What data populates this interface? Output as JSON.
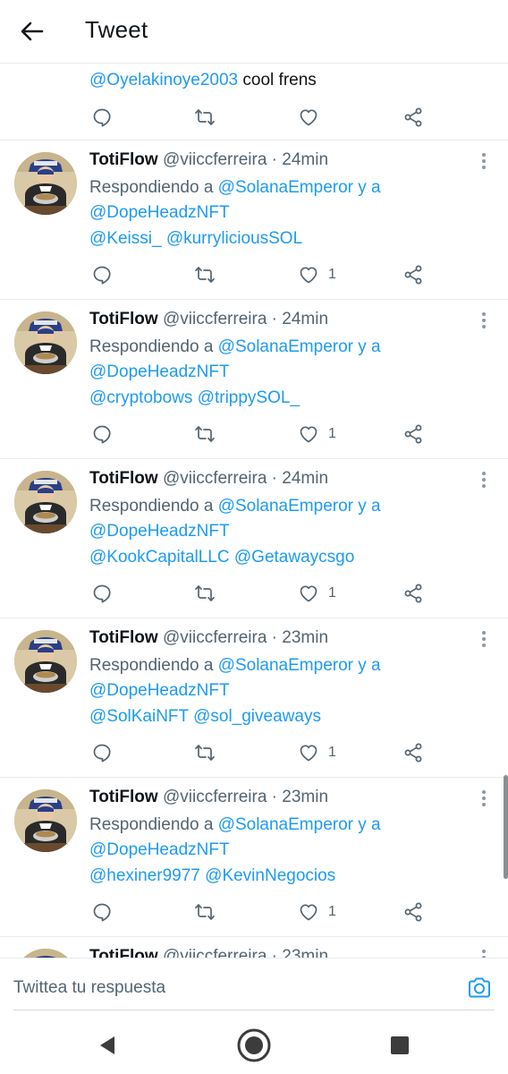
{
  "header": {
    "title": "Tweet"
  },
  "partial_tweet": {
    "mention": "@Oyelakinoye2003",
    "text": "cool frens"
  },
  "tweets": [
    {
      "name": "TotiFlow",
      "handle": "@viiccferreira · 24min",
      "reply_prefix": "Respondiendo a ",
      "reply_user1": "@SolanaEmperor",
      "reply_join": " y a",
      "reply_user2": "@DopeHeadzNFT",
      "mention1": "@Keissi_",
      "mention2": "@kurryliciousSOL",
      "likes": "1"
    },
    {
      "name": "TotiFlow",
      "handle": "@viiccferreira · 24min",
      "reply_prefix": "Respondiendo a ",
      "reply_user1": "@SolanaEmperor",
      "reply_join": " y a",
      "reply_user2": "@DopeHeadzNFT",
      "mention1": "@cryptobows",
      "mention2": "@trippySOL_",
      "likes": "1"
    },
    {
      "name": "TotiFlow",
      "handle": "@viiccferreira · 24min",
      "reply_prefix": "Respondiendo a ",
      "reply_user1": "@SolanaEmperor",
      "reply_join": " y a",
      "reply_user2": "@DopeHeadzNFT",
      "mention1": "@KookCapitalLLC",
      "mention2": "@Getawaycsgo",
      "likes": "1"
    },
    {
      "name": "TotiFlow",
      "handle": "@viiccferreira · 23min",
      "reply_prefix": "Respondiendo a ",
      "reply_user1": "@SolanaEmperor",
      "reply_join": " y a",
      "reply_user2": "@DopeHeadzNFT",
      "mention1": "@SolKaiNFT",
      "mention2": "@sol_giveaways",
      "likes": "1"
    },
    {
      "name": "TotiFlow",
      "handle": "@viiccferreira · 23min",
      "reply_prefix": "Respondiendo a ",
      "reply_user1": "@SolanaEmperor",
      "reply_join": " y a",
      "reply_user2": "@DopeHeadzNFT",
      "mention1": "@hexiner9977",
      "mention2": "@KevinNegocios",
      "likes": "1"
    },
    {
      "name": "TotiFlow",
      "handle": "@viiccferreira · 23min"
    }
  ],
  "reply_bar": {
    "placeholder": "Twittea tu respuesta"
  },
  "colors": {
    "link": "#1d9bf0",
    "muted": "#536471",
    "text": "#0f1419",
    "divider": "#e6ecf0"
  },
  "icons": {
    "back": "arrow-left-icon",
    "reply": "reply-icon",
    "retweet": "retweet-icon",
    "like": "heart-icon",
    "share": "share-icon",
    "more": "more-vertical-icon",
    "camera": "camera-icon",
    "nav_back": "triangle-back-icon",
    "nav_home": "circle-home-icon",
    "nav_recents": "square-recents-icon"
  }
}
